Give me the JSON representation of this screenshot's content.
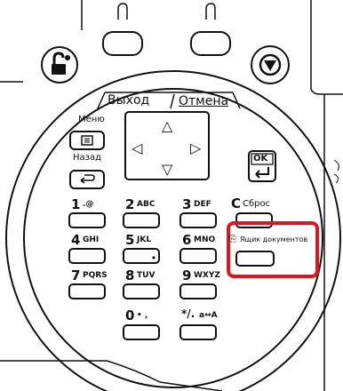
{
  "panel": {
    "soft_keys": {
      "exit": "Выход",
      "cancel": "Отмена"
    },
    "menu_label": "Меню",
    "back_label": "Назад",
    "ok_label": "OK",
    "clear_label": "C",
    "clear_text": "Сброс",
    "doc_box_label": "Ящик документов",
    "keys": [
      {
        "digit": "1",
        "letters": ".@"
      },
      {
        "digit": "2",
        "letters": "ABC"
      },
      {
        "digit": "3",
        "letters": "DEF"
      },
      {
        "digit": "4",
        "letters": "GHI"
      },
      {
        "digit": "5",
        "letters": "JKL"
      },
      {
        "digit": "6",
        "letters": "MNO"
      },
      {
        "digit": "7",
        "letters": "PQRS"
      },
      {
        "digit": "8",
        "letters": "TUV"
      },
      {
        "digit": "9",
        "letters": "WXYZ"
      },
      {
        "digit": "0",
        "letters": "• ,"
      },
      {
        "digit": "*/.",
        "letters": "a↔A"
      }
    ],
    "arrows": {
      "up": "△",
      "down": "▽",
      "left": "◁",
      "right": "▷"
    },
    "highlight_color": "#e0141e"
  }
}
